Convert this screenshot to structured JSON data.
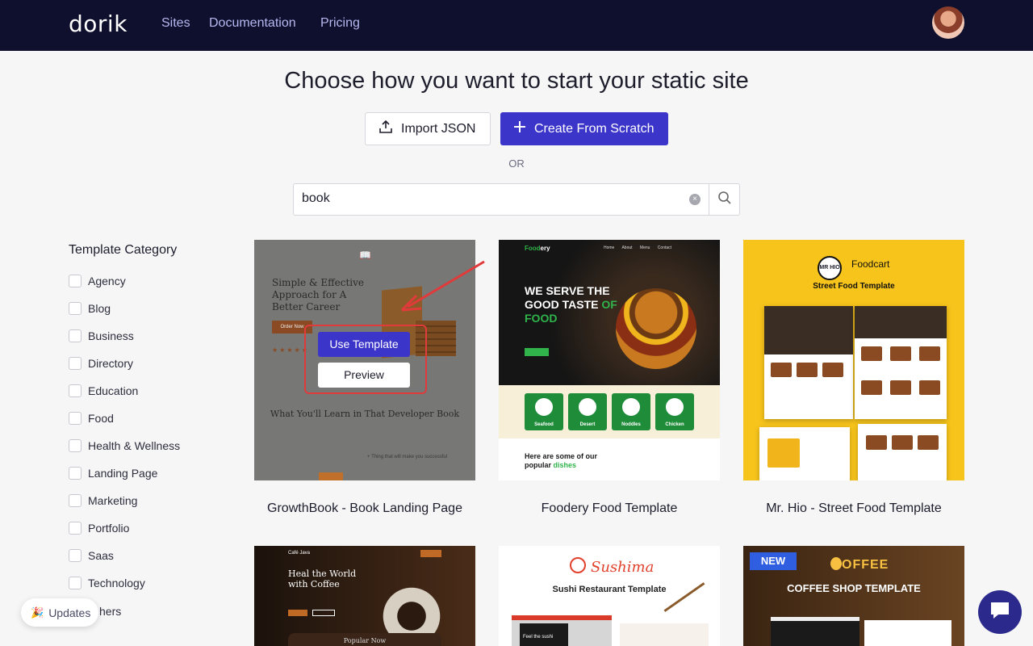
{
  "nav": {
    "logo": "dorik",
    "links": [
      "Sites",
      "Documentation",
      "Pricing"
    ]
  },
  "header": {
    "title": "Choose how you want to start your static site",
    "import_label": "Import JSON",
    "scratch_label": "Create From Scratch",
    "or_label": "OR"
  },
  "search": {
    "value": "book"
  },
  "sidebar": {
    "title": "Template Category",
    "categories": [
      "Agency",
      "Blog",
      "Business",
      "Directory",
      "Education",
      "Food",
      "Health & Wellness",
      "Landing Page",
      "Marketing",
      "Portfolio",
      "Saas",
      "Technology"
    ],
    "partial_last": "hers"
  },
  "cards": [
    {
      "title": "GrowthBook - Book Landing Page",
      "hero": "Simple & Effective Approach for A Better Career",
      "order": "Order Now",
      "learn": "What You'll Learn in That Developer Book",
      "small": "+ Thing that will make you successful",
      "use_label": "Use Template",
      "preview_label": "Preview"
    },
    {
      "title": "Foodery Food Template",
      "brand_a": "Food",
      "brand_b": "ery",
      "menu": "Home About Menu Contact",
      "head_1": "WE SERVE THE",
      "head_2": "GOOD TASTE",
      "head_of": "OF",
      "head_3": "FOOD",
      "tiles": [
        "Seafood",
        "Desert",
        "Noddles",
        "Chicken"
      ],
      "sub_1": "Here are some of our",
      "sub_2": "popular",
      "sub_3": "dishes"
    },
    {
      "title": "Mr. Hio - Street Food Template",
      "logo_text": "MR HIO",
      "foodcart": "Foodcart",
      "subtitle": "Street Food Template"
    },
    {
      "title": "",
      "brand": "Café Java",
      "hero": "Heal the World with Coffee",
      "popular": "Popular Now"
    },
    {
      "title": "",
      "name": "Sushima",
      "subtitle": "Sushi Restaurant Template",
      "feel": "Feel the sushi"
    },
    {
      "title": "",
      "badge": "NEW",
      "brand": "OFFEE",
      "subtitle": "COFFEE SHOP TEMPLATE"
    }
  ],
  "floating": {
    "updates_label": "Updates"
  },
  "colors": {
    "nav_bg": "#0f0f2e",
    "accent": "#3c35c9",
    "annotation": "#e13a3a"
  }
}
